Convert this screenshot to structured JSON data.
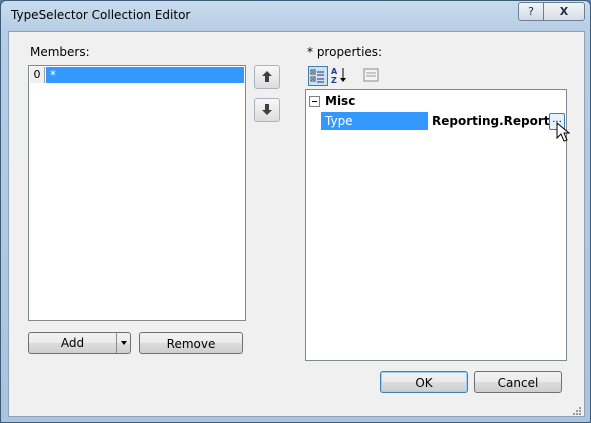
{
  "window": {
    "title": "TypeSelector Collection Editor",
    "help_label": "?",
    "close_label": "X"
  },
  "members": {
    "label": "Members:",
    "items": [
      {
        "index": "0",
        "value": "*"
      }
    ]
  },
  "buttons": {
    "add": "Add",
    "remove": "Remove",
    "ok": "OK",
    "cancel": "Cancel"
  },
  "properties": {
    "label": "* properties:",
    "category": "Misc",
    "row": {
      "name": "Type",
      "value": "Reporting.ReportIter",
      "ellipsis": "..."
    }
  },
  "colors": {
    "selection": "#3399ff",
    "title_bar": "#b7cde4"
  },
  "icons": [
    "up-arrow-icon",
    "down-arrow-icon",
    "categorized-icon",
    "alphabetical-icon",
    "property-pages-icon",
    "dropdown-arrow-icon",
    "mouse-cursor-icon",
    "resize-grip-icon"
  ]
}
